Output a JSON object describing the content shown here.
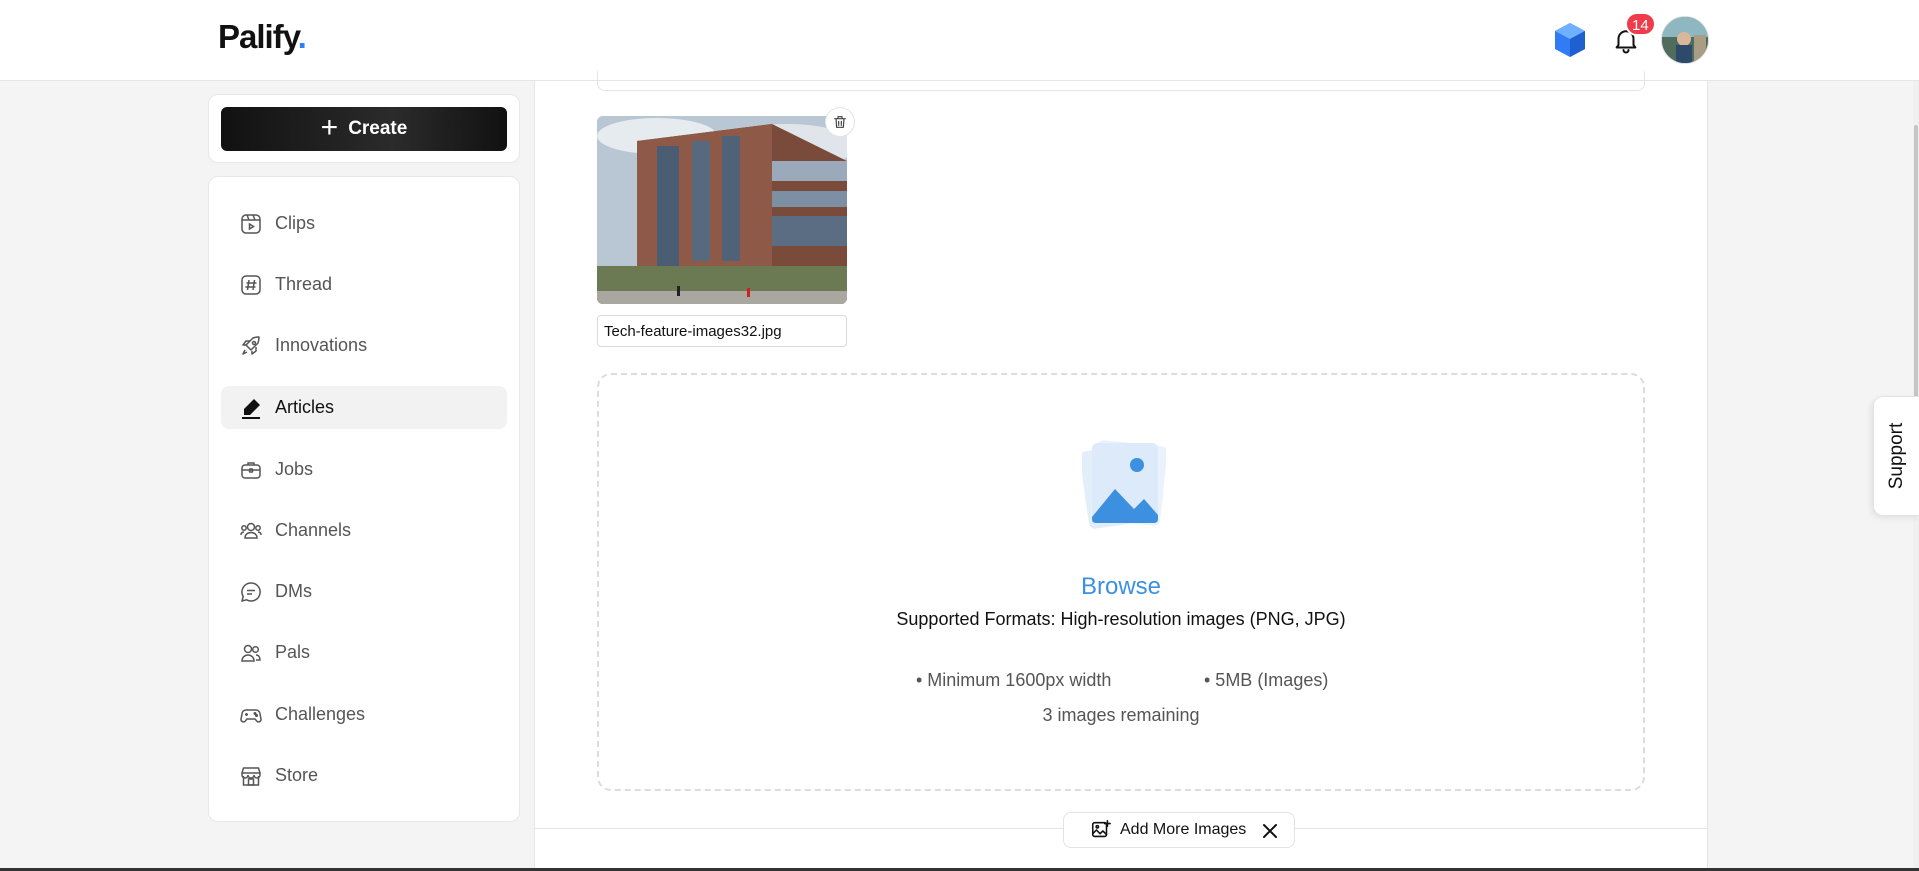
{
  "header": {
    "logo_text": "Palify",
    "logo_dot": ".",
    "notification_count": "14"
  },
  "sidebar": {
    "create_label": "Create",
    "items": [
      {
        "label": "Clips",
        "icon": "clips-icon"
      },
      {
        "label": "Thread",
        "icon": "hash-icon"
      },
      {
        "label": "Innovations",
        "icon": "rocket-icon"
      },
      {
        "label": "Articles",
        "icon": "pen-icon",
        "active": true
      },
      {
        "label": "Jobs",
        "icon": "briefcase-icon"
      },
      {
        "label": "Channels",
        "icon": "users-icon"
      },
      {
        "label": "DMs",
        "icon": "chat-icon"
      },
      {
        "label": "Pals",
        "icon": "pals-icon"
      },
      {
        "label": "Challenges",
        "icon": "gamepad-icon"
      },
      {
        "label": "Store",
        "icon": "store-icon"
      }
    ]
  },
  "upload": {
    "filename": "Tech-feature-images32.jpg",
    "browse_label": "Browse",
    "formats_text": "Supported Formats: High-resolution images (PNG, JPG)",
    "requirement_1": "• Minimum 1600px width",
    "requirement_2": "• 5MB (Images)",
    "remaining_text": "3 images remaining",
    "add_more_label": "Add More Images"
  },
  "support_label": "Support",
  "colors": {
    "accent": "#3d8fe0",
    "badge": "#ef3b4a",
    "logo_dot": "#2f7cf6"
  }
}
